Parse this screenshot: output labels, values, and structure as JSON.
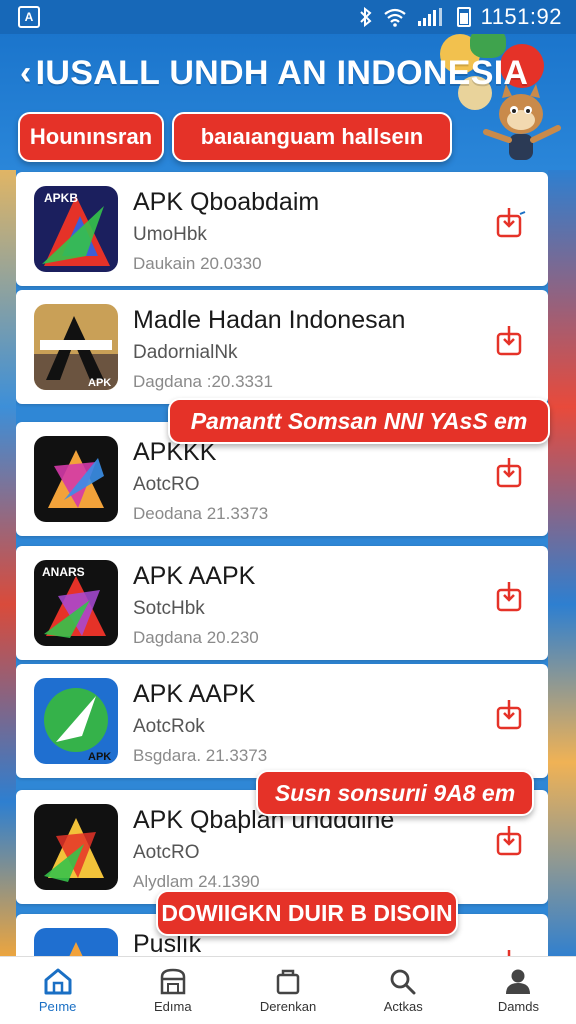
{
  "status_bar": {
    "time": "1151:92"
  },
  "header": {
    "title": "IUSALL UNDH AN INDONESIA",
    "buttons": [
      {
        "label": "Hounınsran"
      },
      {
        "label": "baıaıanguam hallseın"
      }
    ]
  },
  "apps": [
    {
      "name": "APK Qboabdaim",
      "sub": "UmoHbk",
      "meta": "Daukain 20.0330"
    },
    {
      "name": "Madle Hadan Indonesan",
      "sub": "DadornialNk",
      "meta": "Dagdana :20.3331"
    },
    {
      "name": "APKKK",
      "sub": "AotcRO",
      "meta": "Deodana 21.3373"
    },
    {
      "name": "APK AAPK",
      "sub": "SotcHbk",
      "meta": "Dagdana 20.230"
    },
    {
      "name": "APK AAPK",
      "sub": "AotcRok",
      "meta": "Bsgdara. 21.3373"
    },
    {
      "name": "APK Qbaþlan undddine",
      "sub": "AotcRO",
      "meta": "Alydlam 24.1390"
    },
    {
      "name": "Puslık",
      "sub": "",
      "meta": ""
    }
  ],
  "banners": [
    {
      "label": "Pamantt Somsan NNI YAsS em"
    },
    {
      "label": "Susn sonsurıi 9A8 em"
    },
    {
      "label": "DOWIIGKN DUIR B DISOIN"
    }
  ],
  "bottom_nav": [
    {
      "label": "Peıme",
      "icon": "home-icon",
      "active": true
    },
    {
      "label": "Edıma",
      "icon": "store-icon",
      "active": false
    },
    {
      "label": "Derenkan",
      "icon": "bag-icon",
      "active": false
    },
    {
      "label": "Actkas",
      "icon": "search-icon",
      "active": false
    },
    {
      "label": "Damds",
      "icon": "user-icon",
      "active": false
    }
  ],
  "colors": {
    "accent": "#e53228",
    "primary": "#1b75cc",
    "nav_active": "#1a6fc4"
  }
}
